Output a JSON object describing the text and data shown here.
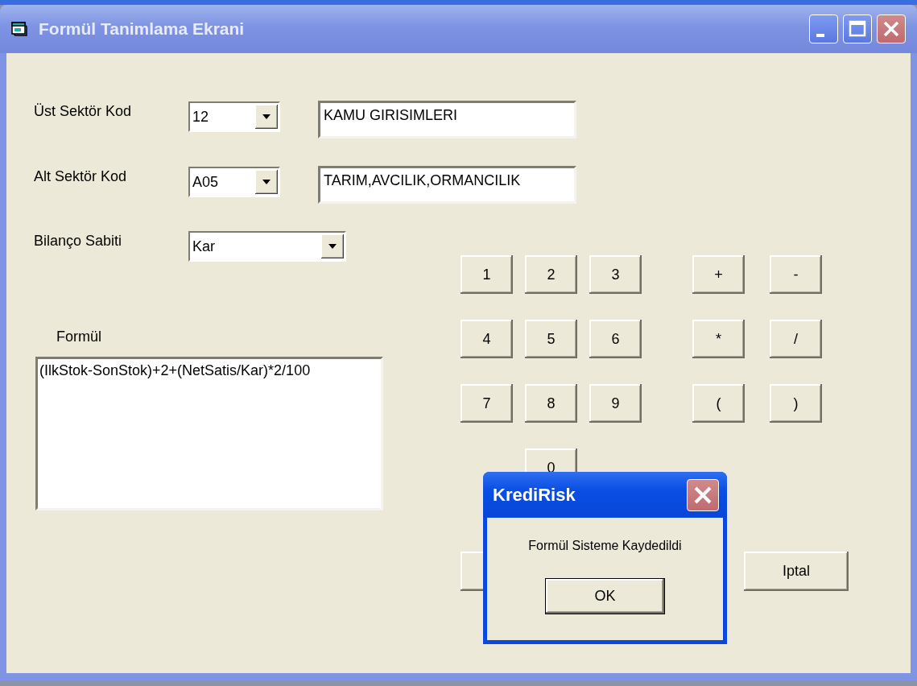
{
  "window": {
    "title": "Formül Tanimlama Ekrani"
  },
  "fields": [
    {
      "label": "Üst Sektör Kod",
      "code": "12",
      "description": "KAMU GIRISIMLERI"
    },
    {
      "label": "Alt Sektör Kod",
      "code": "A05",
      "description": "TARIM,AVCILIK,ORMANCILIK"
    }
  ],
  "balance_constant": {
    "label": "Bilanço Sabiti",
    "value": "Kar"
  },
  "formula": {
    "label": "Formül",
    "value": "(IlkStok-SonStok)+2+(NetSatis/Kar)*2/100"
  },
  "digits": [
    "1",
    "2",
    "3",
    "4",
    "5",
    "6",
    "7",
    "8",
    "9",
    "0"
  ],
  "operators": [
    "+",
    "-",
    "*",
    "/",
    "(",
    ")"
  ],
  "cancel_button": "Iptal",
  "dialog": {
    "title": "KrediRisk",
    "message": "Formül Sisteme Kaydedildi",
    "ok": "OK"
  }
}
